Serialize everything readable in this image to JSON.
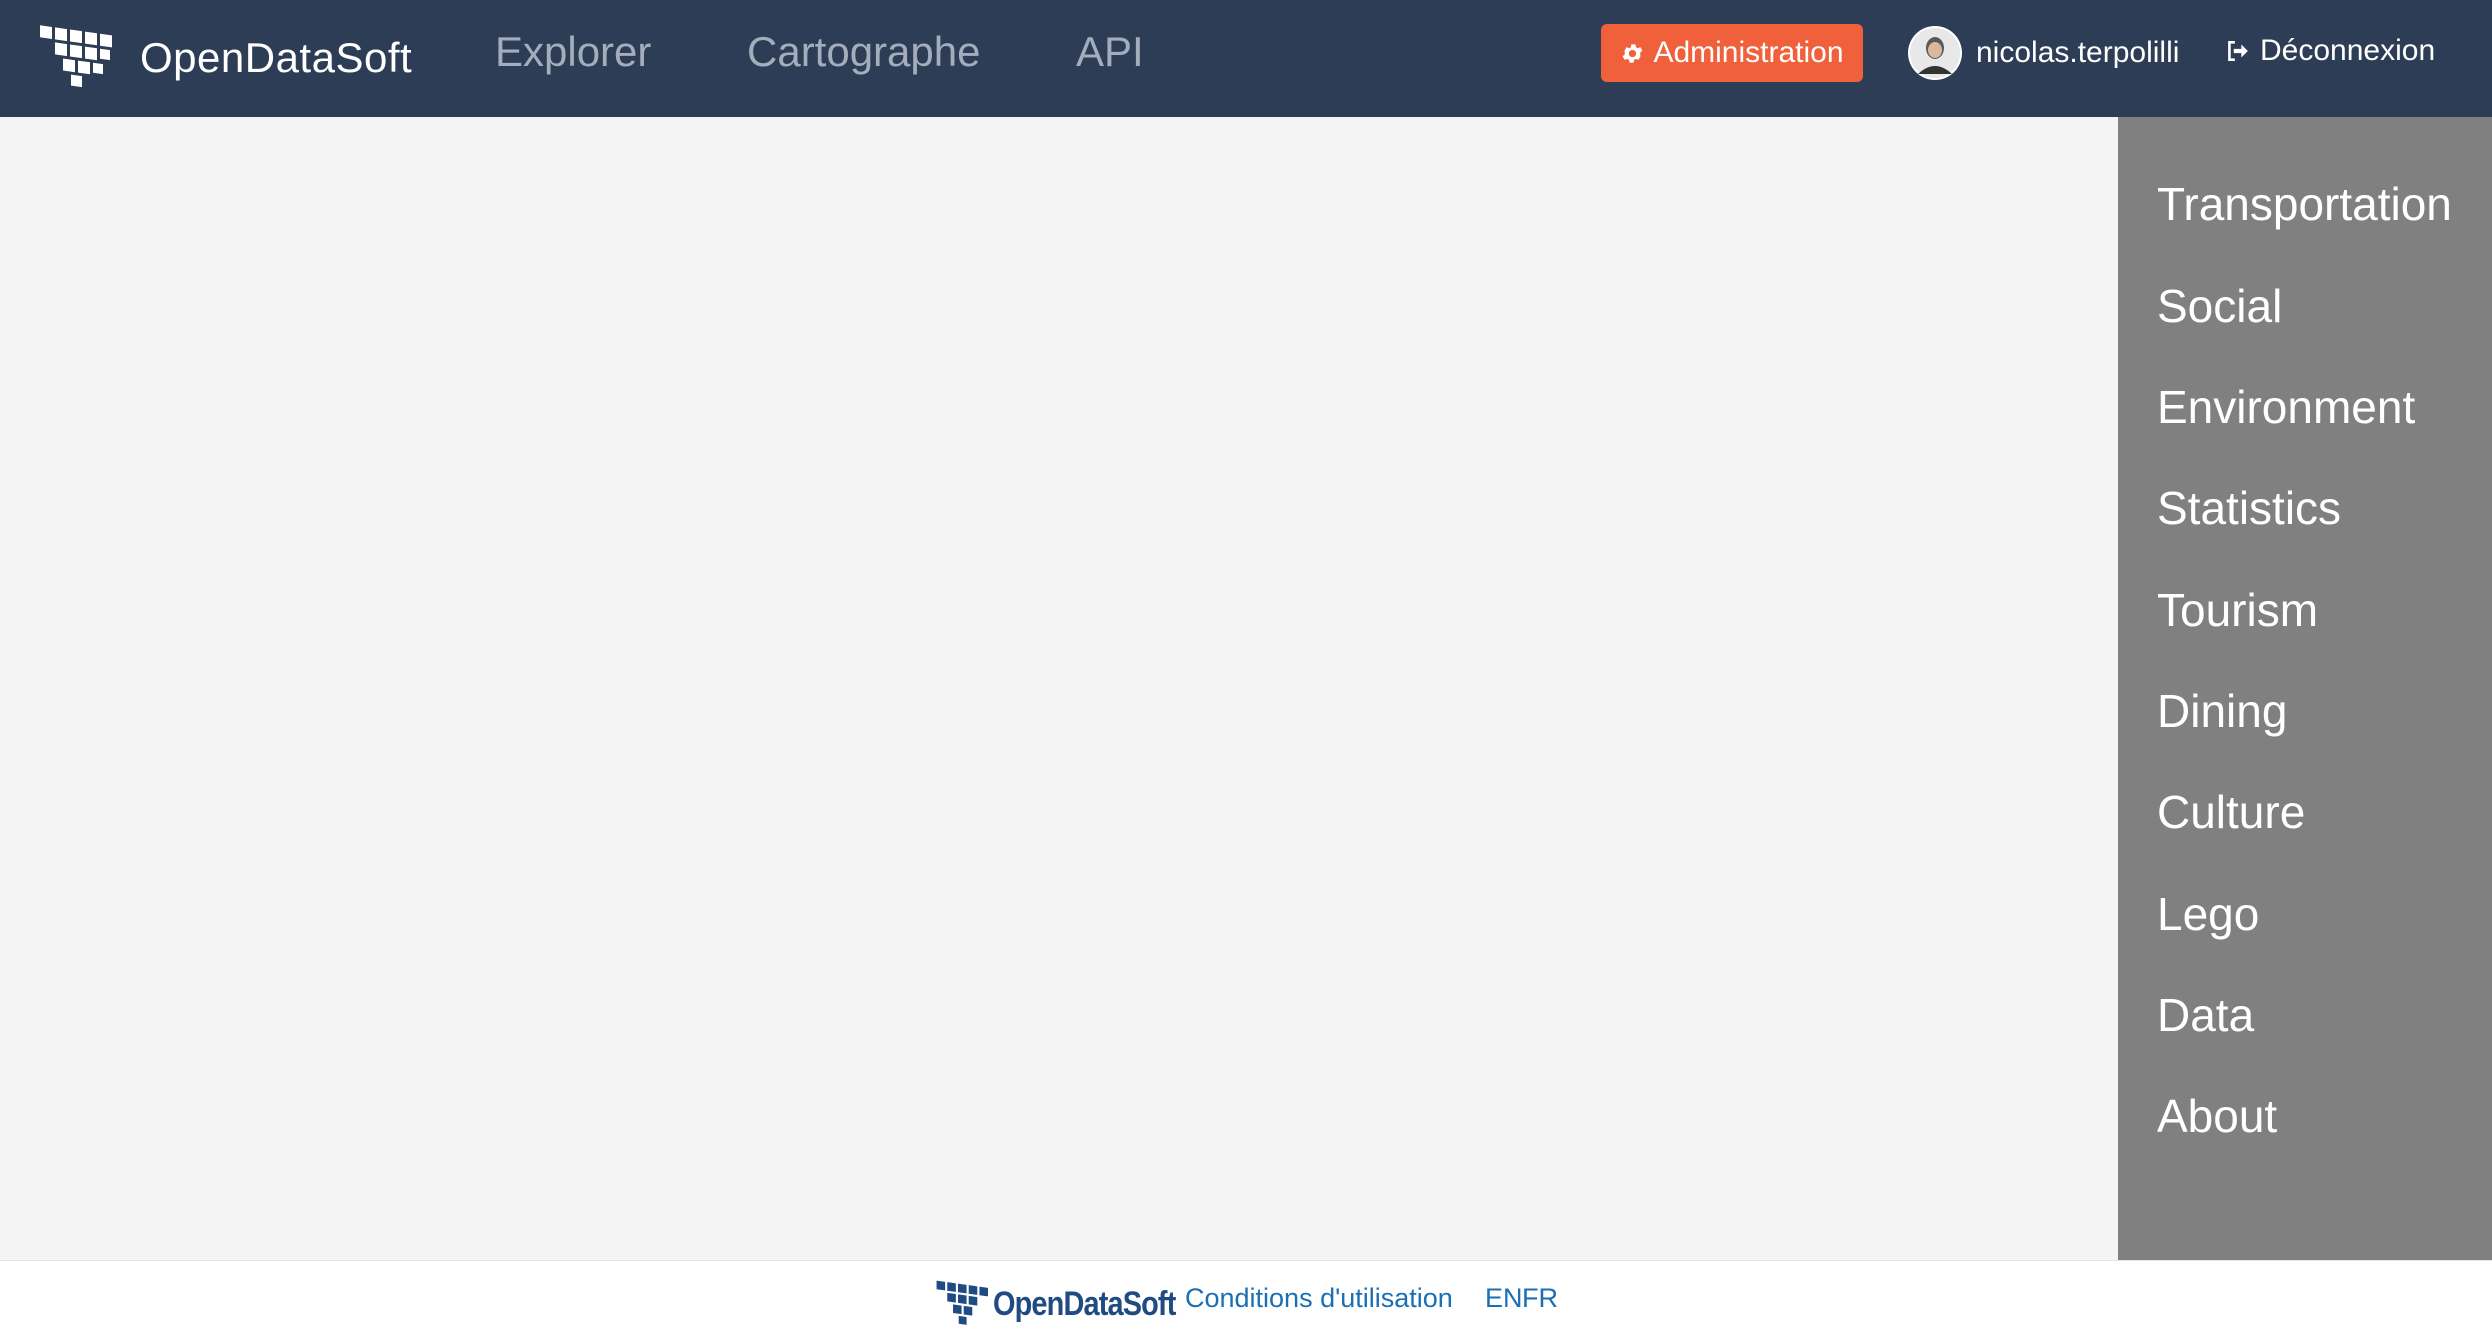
{
  "header": {
    "brand_name": "OpenDataSoft",
    "nav": {
      "explorer": "Explorer",
      "cartographe": "Cartographe",
      "api": "API"
    },
    "admin_label": "Administration",
    "username": "nicolas.terpolilli",
    "logout_label": "Déconnexion"
  },
  "side_menu": {
    "items": [
      "Transportation",
      "Social",
      "Environment",
      "Statistics",
      "Tourism",
      "Dining",
      "Culture",
      "Lego",
      "Data",
      "About"
    ]
  },
  "footer": {
    "logo_text": "OpenDataSoft",
    "terms_label": "Conditions d'utilisation",
    "lang_en": "EN",
    "lang_fr": "FR"
  },
  "colors": {
    "header_bg": "#2d3d56",
    "admin_accent": "#f0613b",
    "side_menu_bg": "#808080",
    "content_bg": "#f4f4f4",
    "footer_link": "#1a6fb5"
  },
  "icons": [
    "opendatasoft-logo-icon",
    "gear-icon",
    "avatar",
    "logout-icon"
  ]
}
